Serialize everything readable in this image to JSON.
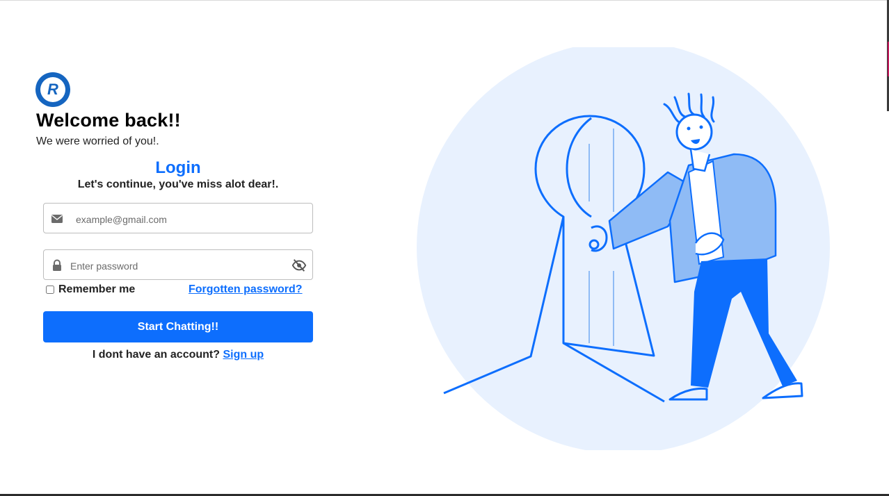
{
  "brand": {
    "logo_letter": "R",
    "icon": "chat-bubble-r-logo"
  },
  "header": {
    "title": "Welcome back!!",
    "subtitle": "We were worried of you!."
  },
  "login": {
    "title": "Login",
    "subtitle": "Let's continue, you've miss alot dear!."
  },
  "form": {
    "email": {
      "placeholder": "example@gmail.com",
      "value": "",
      "icon": "envelope-icon"
    },
    "password": {
      "placeholder": "Enter password",
      "value": "",
      "icon": "lock-icon",
      "toggle_icon": "eye-slash-icon"
    },
    "remember_label": "Remember me",
    "remember_checked": false,
    "forgot_label": "Forgotten password?",
    "submit_label": "Start Chatting!!",
    "signup_prompt": "I dont have an account?",
    "signup_label": "Sign up"
  },
  "colors": {
    "primary": "#0d6efd",
    "illustration_bg": "#e8f1fe",
    "illustration_stroke": "#0d6efd",
    "illustration_light": "#8fbbf5"
  }
}
